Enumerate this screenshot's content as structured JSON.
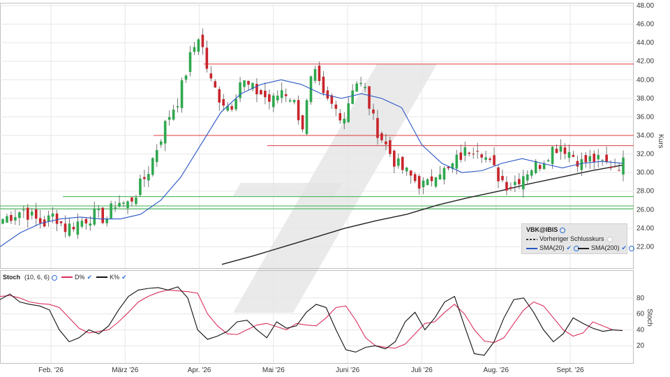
{
  "chart_data": [
    {
      "type": "candlestick",
      "symbol": "VBK@IBIS",
      "ylabel": "Kurs",
      "ylim": [
        20,
        48
      ],
      "y_ticks": [
        "48.00",
        "46.00",
        "44.00",
        "42.00",
        "40.00",
        "38.00",
        "36.00",
        "34.00",
        "32.00",
        "30.00",
        "28.00",
        "26.00",
        "24.00",
        "22.00"
      ],
      "x_ticks": [
        "Feb. '26",
        "März '26",
        "Apr. '26",
        "Mai '26",
        "Juni '26",
        "Juli '26",
        "Aug. '26",
        "Sept. '26"
      ],
      "legend": {
        "title": "VBK@IBIS",
        "items": [
          "Vorheriger Schlusskurs",
          "SMA(20)",
          "SMA(200)"
        ]
      },
      "series": [
        {
          "name": "Kurs",
          "close_anchors": [
            25.0,
            25.5,
            26.0,
            25.0,
            24.5,
            25.5,
            24.0,
            24.5,
            25.0,
            25.5,
            25.0,
            27.0,
            26.5,
            28.0,
            30.0,
            33.0,
            36.0,
            38.0,
            42.0,
            45.0,
            40.0,
            38.0,
            37.0,
            40.0,
            39.0,
            38.5,
            37.5,
            39.0,
            38.0,
            35.0,
            41.0,
            38.0,
            37.0,
            36.0,
            40.0,
            39.0,
            35.0,
            33.0,
            31.0,
            30.0,
            29.0,
            28.5,
            30.5,
            30.0,
            31.5,
            32.5,
            33.0,
            31.0,
            29.5,
            28.5,
            29.5,
            30.5,
            31.0,
            32.5,
            33.0,
            32.0,
            31.0,
            31.5,
            31.0,
            30.8,
            31.0
          ]
        },
        {
          "name": "SMA(20)",
          "values": [
            22.0,
            23.5,
            24.5,
            25.0,
            25.2,
            25.0,
            25.0,
            25.5,
            27.0,
            29.5,
            33.0,
            36.5,
            38.5,
            39.5,
            40.0,
            39.5,
            38.5,
            38.0,
            38.5,
            38.0,
            37.0,
            33.0,
            31.0,
            30.0,
            30.2,
            31.0,
            31.5,
            31.0,
            30.5,
            31.0,
            31.2,
            31.0
          ]
        },
        {
          "name": "SMA(200)",
          "values": [
            20.1,
            21.0,
            22.0,
            23.0,
            24.0,
            24.8,
            25.5,
            26.5,
            27.3,
            28.0,
            28.8,
            29.5,
            30.2,
            30.8
          ]
        }
      ],
      "horizontal_lines": [
        {
          "value": 41.7,
          "color": "#e03b3b"
        },
        {
          "value": 34.0,
          "color": "#e03b3b"
        },
        {
          "value": 32.9,
          "color": "#e03b3b"
        },
        {
          "value": 27.4,
          "color": "#35b24a"
        },
        {
          "value": 26.4,
          "color": "#35b24a"
        },
        {
          "value": 26.1,
          "color": "#35b24a"
        }
      ]
    },
    {
      "type": "line",
      "title": "Stoch",
      "params": "(10, 6, 6)",
      "ylabel": "Stoch",
      "ylim": [
        0,
        100
      ],
      "y_ticks": [
        "80",
        "60",
        "40",
        "20"
      ],
      "series": [
        {
          "name": "D%",
          "color": "#d9305c",
          "values": [
            82,
            83,
            80,
            75,
            73,
            72,
            68,
            55,
            42,
            36,
            38,
            40,
            50,
            62,
            75,
            82,
            87,
            90,
            89,
            88,
            86,
            60,
            45,
            35,
            34,
            40,
            46,
            48,
            44,
            40,
            48,
            46,
            45,
            55,
            68,
            70,
            52,
            30,
            20,
            18,
            17,
            22,
            35,
            48,
            50,
            62,
            72,
            60,
            40,
            26,
            24,
            30,
            48,
            65,
            75,
            70,
            55,
            40,
            32,
            36,
            50,
            45,
            40,
            39
          ]
        },
        {
          "name": "K%",
          "color": "#111111",
          "values": [
            78,
            85,
            75,
            72,
            70,
            65,
            40,
            25,
            30,
            40,
            35,
            45,
            65,
            82,
            90,
            92,
            93,
            90,
            94,
            80,
            40,
            28,
            32,
            38,
            50,
            52,
            40,
            30,
            50,
            42,
            45,
            62,
            72,
            68,
            40,
            15,
            12,
            18,
            20,
            16,
            25,
            50,
            62,
            40,
            55,
            75,
            82,
            45,
            10,
            8,
            25,
            55,
            78,
            80,
            62,
            40,
            25,
            35,
            55,
            48,
            42,
            38,
            40,
            39
          ]
        }
      ]
    }
  ],
  "colors": {
    "up": "#2fa84f",
    "down": "#c8252c",
    "sma20": "#2a56c6",
    "sma200": "#222222",
    "watermark": "#e3e3e3",
    "grid": "#e6e6e6"
  }
}
